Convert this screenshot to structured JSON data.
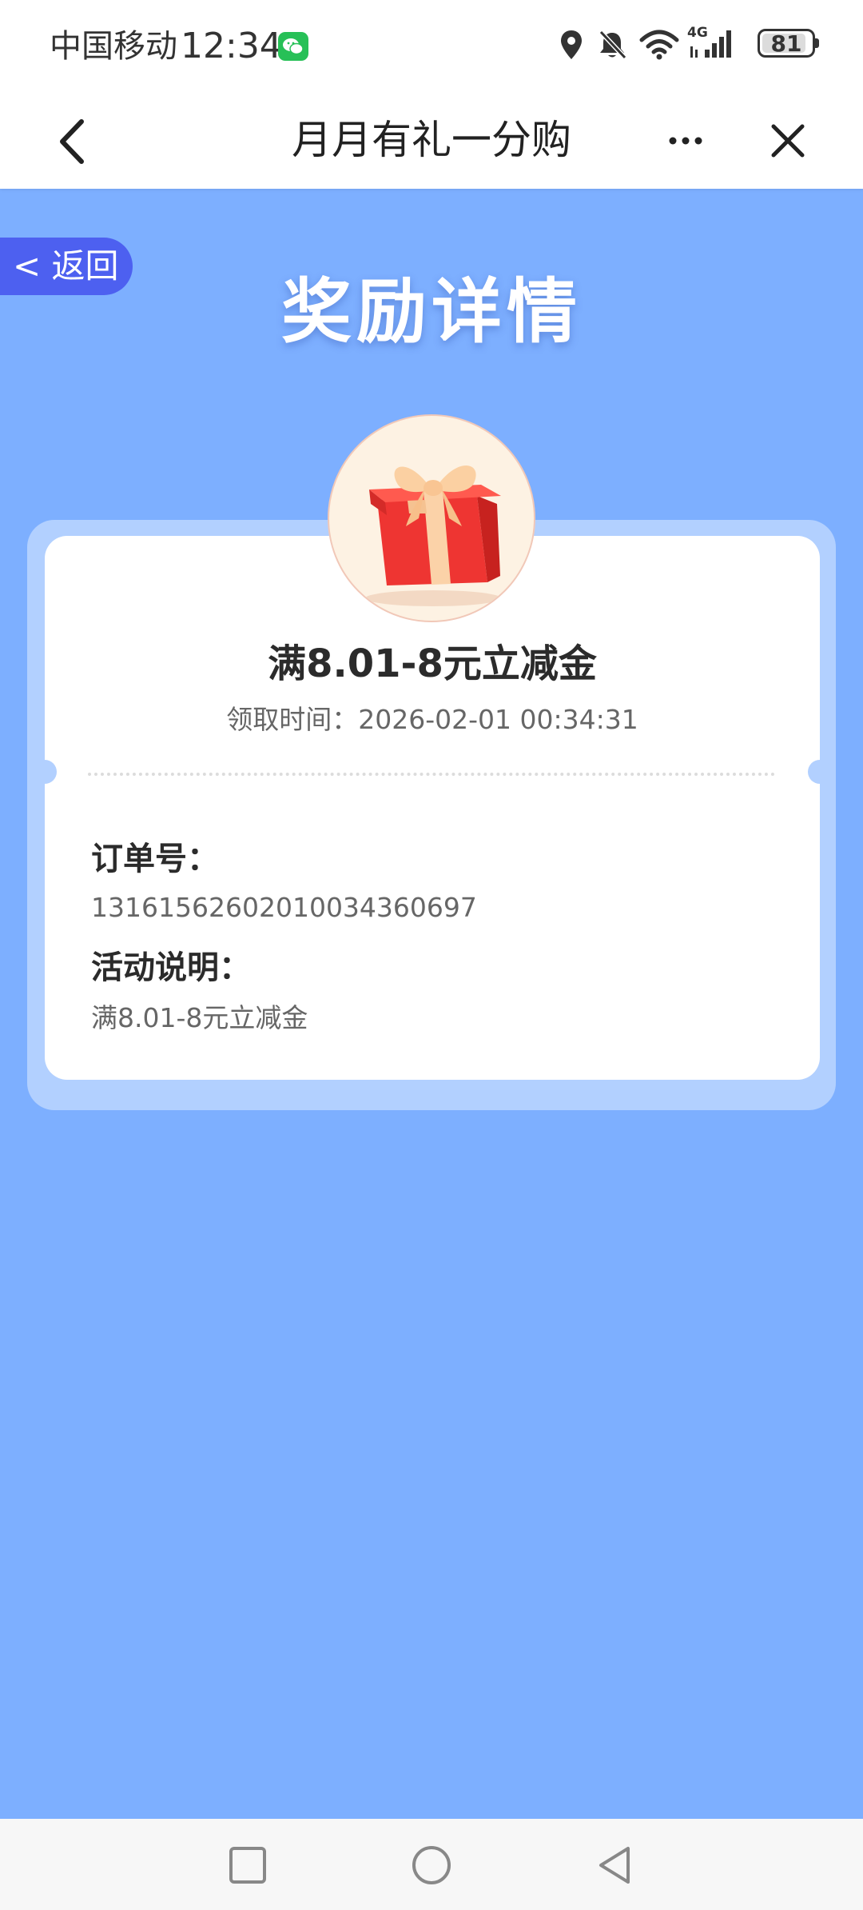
{
  "status_bar": {
    "carrier": "中国移动",
    "time": "12:34",
    "network_label": "4G",
    "battery": "81",
    "icons": [
      "wechat-icon",
      "location-icon",
      "bell-off-icon",
      "wifi-icon",
      "signal-icon",
      "battery-icon"
    ]
  },
  "title_bar": {
    "title": "月月有礼一分购",
    "icons": [
      "back-arrow-icon",
      "more-dots-icon",
      "close-icon"
    ]
  },
  "page": {
    "return_label": "< 返回",
    "heading": "奖励详情"
  },
  "reward": {
    "icon": "gift-box-icon",
    "title": "满8.01-8元立减金",
    "claim_time": "领取时间：2026-02-01 00:34:31",
    "order_label": "订单号：",
    "order_number": "1316156260201003436069​7",
    "desc_label": "活动说明：",
    "desc_value": "满8.01-8元立减金"
  },
  "system_nav": {
    "icons": [
      "recent-apps-icon",
      "home-icon",
      "back-triangle-icon"
    ]
  },
  "colors": {
    "page_background": "#7dafff",
    "card_outer": "#b2d0ff",
    "return_pill": "#4d60f0",
    "gift_red": "#f03a36"
  }
}
